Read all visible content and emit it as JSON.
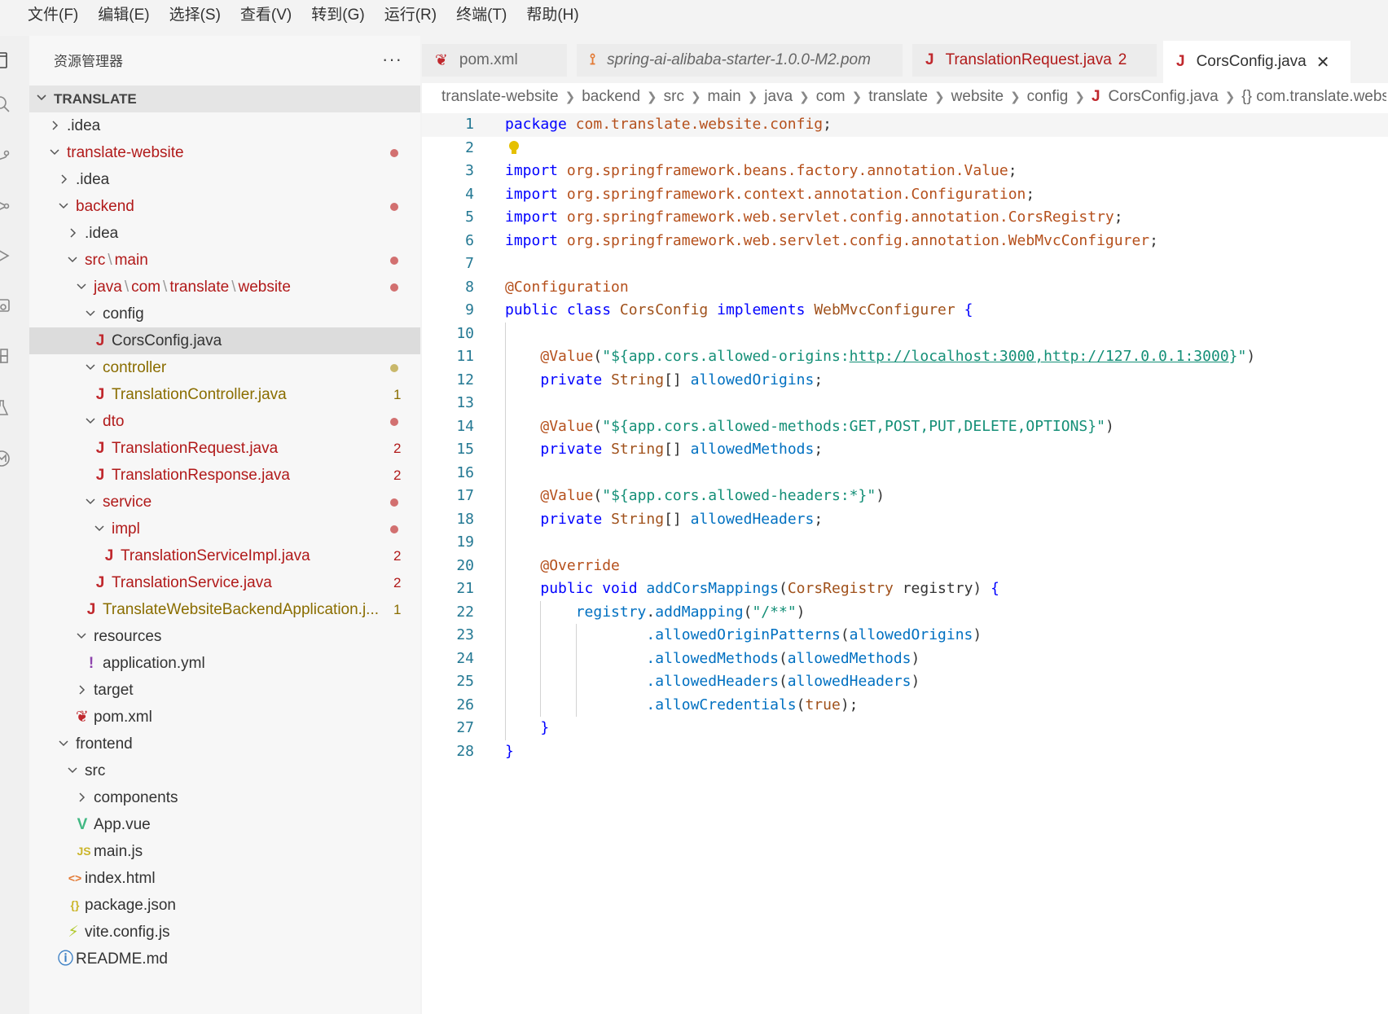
{
  "menu": [
    "文件(F)",
    "编辑(E)",
    "选择(S)",
    "查看(V)",
    "转到(G)",
    "运行(R)",
    "终端(T)",
    "帮助(H)"
  ],
  "sidebar": {
    "title": "资源管理器",
    "more": "···",
    "section": "TRANSLATE",
    "tree": [
      {
        "label": ".idea",
        "depth": 0,
        "chev": "right"
      },
      {
        "label": "translate-website",
        "depth": 0,
        "chev": "down",
        "color": "#b11a1a",
        "dot": "#d27070"
      },
      {
        "label": ".idea",
        "depth": 1,
        "chev": "right"
      },
      {
        "label": "backend",
        "depth": 1,
        "chev": "down",
        "color": "#b11a1a",
        "dot": "#d27070"
      },
      {
        "label": ".idea",
        "depth": 2,
        "chev": "right"
      },
      {
        "label": "src\\main",
        "depth": 2,
        "chev": "down",
        "color": "#b11a1a",
        "dot": "#d27070"
      },
      {
        "label": "java\\com\\translate\\website",
        "depth": 3,
        "chev": "down",
        "color": "#b11a1a",
        "dot": "#d27070"
      },
      {
        "label": "config",
        "depth": 4,
        "chev": "down"
      },
      {
        "label": "CorsConfig.java",
        "depth": 5,
        "icon": "J",
        "iconColor": "#c0282d",
        "selected": true
      },
      {
        "label": "controller",
        "depth": 4,
        "chev": "down",
        "color": "#8a6d00",
        "dot": "#c9b86b"
      },
      {
        "label": "TranslationController.java",
        "depth": 5,
        "icon": "J",
        "iconColor": "#c0282d",
        "color": "#8a6d00",
        "count": "1"
      },
      {
        "label": "dto",
        "depth": 4,
        "chev": "down",
        "color": "#b11a1a",
        "dot": "#d27070"
      },
      {
        "label": "TranslationRequest.java",
        "depth": 5,
        "icon": "J",
        "iconColor": "#c0282d",
        "color": "#b11a1a",
        "count": "2"
      },
      {
        "label": "TranslationResponse.java",
        "depth": 5,
        "icon": "J",
        "iconColor": "#c0282d",
        "color": "#b11a1a",
        "count": "2"
      },
      {
        "label": "service",
        "depth": 4,
        "chev": "down",
        "color": "#b11a1a",
        "dot": "#d27070"
      },
      {
        "label": "impl",
        "depth": 5,
        "chev": "down",
        "color": "#b11a1a",
        "dot": "#d27070"
      },
      {
        "label": "TranslationServiceImpl.java",
        "depth": 6,
        "icon": "J",
        "iconColor": "#c0282d",
        "color": "#b11a1a",
        "count": "2"
      },
      {
        "label": "TranslationService.java",
        "depth": 5,
        "icon": "J",
        "iconColor": "#c0282d",
        "color": "#b11a1a",
        "count": "2"
      },
      {
        "label": "TranslateWebsiteBackendApplication.j...",
        "depth": 4,
        "icon": "J",
        "iconColor": "#c0282d",
        "color": "#8a6d00",
        "count": "1"
      },
      {
        "label": "resources",
        "depth": 3,
        "chev": "down"
      },
      {
        "label": "application.yml",
        "depth": 4,
        "icon": "!",
        "iconColor": "#8e44ad"
      },
      {
        "label": "target",
        "depth": 3,
        "chev": "right"
      },
      {
        "label": "pom.xml",
        "depth": 3,
        "icon": "❦",
        "iconColor": "#c0282d"
      },
      {
        "label": "frontend",
        "depth": 1,
        "chev": "down"
      },
      {
        "label": "src",
        "depth": 2,
        "chev": "down"
      },
      {
        "label": "components",
        "depth": 3,
        "chev": "right"
      },
      {
        "label": "App.vue",
        "depth": 3,
        "icon": "V",
        "iconColor": "#41b883"
      },
      {
        "label": "main.js",
        "depth": 3,
        "icon": "JS",
        "iconColor": "#cbb52a"
      },
      {
        "label": "index.html",
        "depth": 2,
        "icon": "<>",
        "iconColor": "#e37933"
      },
      {
        "label": "package.json",
        "depth": 2,
        "icon": "{}",
        "iconColor": "#cbb52a"
      },
      {
        "label": "vite.config.js",
        "depth": 2,
        "icon": "⚡",
        "iconColor": "#b0c92a"
      },
      {
        "label": "README.md",
        "depth": 1,
        "icon": "ⓘ",
        "iconColor": "#3b7fc4"
      }
    ]
  },
  "tabs": [
    {
      "label": "pom.xml",
      "icon": "❦",
      "iconColor": "#c0282d",
      "italic": false
    },
    {
      "label": "spring-ai-alibaba-starter-1.0.0-M2.pom",
      "icon": "⟟",
      "iconColor": "#e37933",
      "italic": true
    },
    {
      "label": "TranslationRequest.java",
      "icon": "J",
      "iconColor": "#c0282d",
      "color": "#b11a1a",
      "badge": "2"
    },
    {
      "label": "CorsConfig.java",
      "icon": "J",
      "iconColor": "#c0282d",
      "active": true,
      "close": "✕"
    }
  ],
  "breadcrumb": [
    "translate-website",
    "backend",
    "src",
    "main",
    "java",
    "com",
    "translate",
    "website",
    "config",
    "CorsConfig.java",
    "{} com.translate.websit"
  ],
  "code": {
    "current_line": 1,
    "lines": [
      [
        [
          "k",
          "package"
        ],
        [
          "t",
          " "
        ],
        [
          "pkg",
          "com.translate.website.config"
        ],
        [
          "t",
          ";"
        ]
      ],
      [],
      [
        [
          "k",
          "import"
        ],
        [
          "t",
          " "
        ],
        [
          "pkg",
          "org.springframework.beans.factory.annotation.Value"
        ],
        [
          "t",
          ";"
        ]
      ],
      [
        [
          "k",
          "import"
        ],
        [
          "t",
          " "
        ],
        [
          "pkg",
          "org.springframework.context.annotation.Configuration"
        ],
        [
          "t",
          ";"
        ]
      ],
      [
        [
          "k",
          "import"
        ],
        [
          "t",
          " "
        ],
        [
          "pkg",
          "org.springframework.web.servlet.config.annotation.CorsRegistry"
        ],
        [
          "t",
          ";"
        ]
      ],
      [
        [
          "k",
          "import"
        ],
        [
          "t",
          " "
        ],
        [
          "pkg",
          "org.springframework.web.servlet.config.annotation.WebMvcConfigurer"
        ],
        [
          "t",
          ";"
        ]
      ],
      [],
      [
        [
          "an",
          "@Configuration"
        ]
      ],
      [
        [
          "k",
          "public class"
        ],
        [
          "t",
          " "
        ],
        [
          "ty",
          "CorsConfig"
        ],
        [
          "t",
          " "
        ],
        [
          "k",
          "implements"
        ],
        [
          "t",
          " "
        ],
        [
          "ty",
          "WebMvcConfigurer"
        ],
        [
          "t",
          " "
        ],
        [
          "k",
          "{"
        ]
      ],
      [],
      [
        [
          "t",
          "    "
        ],
        [
          "an",
          "@Value"
        ],
        [
          "t",
          "("
        ],
        [
          "str",
          "\"${app.cors.allowed-origins:"
        ],
        [
          "url",
          "http://localhost:3000,http://127.0.0.1:3000"
        ],
        [
          "str",
          "}\""
        ],
        [
          "t",
          ")"
        ]
      ],
      [
        [
          "t",
          "    "
        ],
        [
          "k",
          "private"
        ],
        [
          "t",
          " "
        ],
        [
          "ty",
          "String"
        ],
        [
          "t",
          "[] "
        ],
        [
          "fn",
          "allowedOrigins"
        ],
        [
          "t",
          ";"
        ]
      ],
      [],
      [
        [
          "t",
          "    "
        ],
        [
          "an",
          "@Value"
        ],
        [
          "t",
          "("
        ],
        [
          "str",
          "\"${app.cors.allowed-methods:GET,POST,PUT,DELETE,OPTIONS}\""
        ],
        [
          "t",
          ")"
        ]
      ],
      [
        [
          "t",
          "    "
        ],
        [
          "k",
          "private"
        ],
        [
          "t",
          " "
        ],
        [
          "ty",
          "String"
        ],
        [
          "t",
          "[] "
        ],
        [
          "fn",
          "allowedMethods"
        ],
        [
          "t",
          ";"
        ]
      ],
      [],
      [
        [
          "t",
          "    "
        ],
        [
          "an",
          "@Value"
        ],
        [
          "t",
          "("
        ],
        [
          "str",
          "\"${app.cors.allowed-headers:*}\""
        ],
        [
          "t",
          ")"
        ]
      ],
      [
        [
          "t",
          "    "
        ],
        [
          "k",
          "private"
        ],
        [
          "t",
          " "
        ],
        [
          "ty",
          "String"
        ],
        [
          "t",
          "[] "
        ],
        [
          "fn",
          "allowedHeaders"
        ],
        [
          "t",
          ";"
        ]
      ],
      [],
      [
        [
          "t",
          "    "
        ],
        [
          "an",
          "@Override"
        ]
      ],
      [
        [
          "t",
          "    "
        ],
        [
          "k",
          "public void"
        ],
        [
          "t",
          " "
        ],
        [
          "fn",
          "addCorsMappings"
        ],
        [
          "t",
          "("
        ],
        [
          "ty",
          "CorsRegistry"
        ],
        [
          "t",
          " registry) "
        ],
        [
          "k",
          "{"
        ]
      ],
      [
        [
          "t",
          "        "
        ],
        [
          "fn",
          "registry"
        ],
        [
          "t",
          "."
        ],
        [
          "fn",
          "addMapping"
        ],
        [
          "t",
          "("
        ],
        [
          "str",
          "\"/**\""
        ],
        [
          "t",
          ")"
        ]
      ],
      [
        [
          "t",
          "                "
        ],
        [
          "fn",
          ".allowedOriginPatterns"
        ],
        [
          "t",
          "("
        ],
        [
          "fn",
          "allowedOrigins"
        ],
        [
          "t",
          ")"
        ]
      ],
      [
        [
          "t",
          "                "
        ],
        [
          "fn",
          ".allowedMethods"
        ],
        [
          "t",
          "("
        ],
        [
          "fn",
          "allowedMethods"
        ],
        [
          "t",
          ")"
        ]
      ],
      [
        [
          "t",
          "                "
        ],
        [
          "fn",
          ".allowedHeaders"
        ],
        [
          "t",
          "("
        ],
        [
          "fn",
          "allowedHeaders"
        ],
        [
          "t",
          ")"
        ]
      ],
      [
        [
          "t",
          "                "
        ],
        [
          "fn",
          ".allowCredentials"
        ],
        [
          "t",
          "("
        ],
        [
          "bool",
          "true"
        ],
        [
          "t",
          ");"
        ]
      ],
      [
        [
          "t",
          "    "
        ],
        [
          "k",
          "}"
        ]
      ],
      [
        [
          "k",
          "}"
        ]
      ]
    ]
  }
}
